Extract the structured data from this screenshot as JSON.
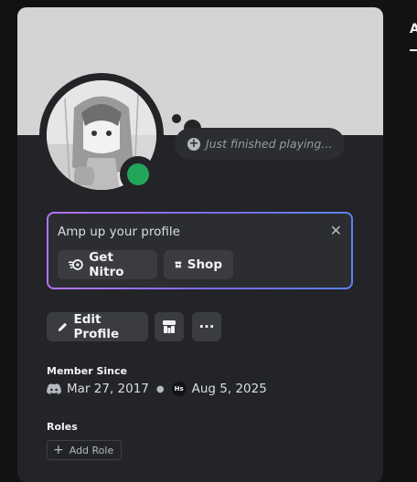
{
  "status_bubble": {
    "text": "Just finished playing..."
  },
  "nitro_promo": {
    "title": "Amp up your profile",
    "close_glyph": "✕",
    "nitro_label": "Get Nitro",
    "shop_label": "Shop"
  },
  "actions": {
    "edit_profile_label": "Edit Profile",
    "more_glyph": "···"
  },
  "member_since": {
    "heading": "Member Since",
    "discord_date": "Mar 27, 2017",
    "server_initials": "Hs",
    "server_date": "Aug 5, 2025"
  },
  "roles": {
    "heading": "Roles",
    "add_role_label": "Add Role"
  },
  "right_panel": {
    "tab_letter": "A"
  },
  "colors": {
    "online": "#23a55a",
    "nitro_gradient_start": "#b473f5",
    "nitro_gradient_end": "#5c82f0"
  }
}
